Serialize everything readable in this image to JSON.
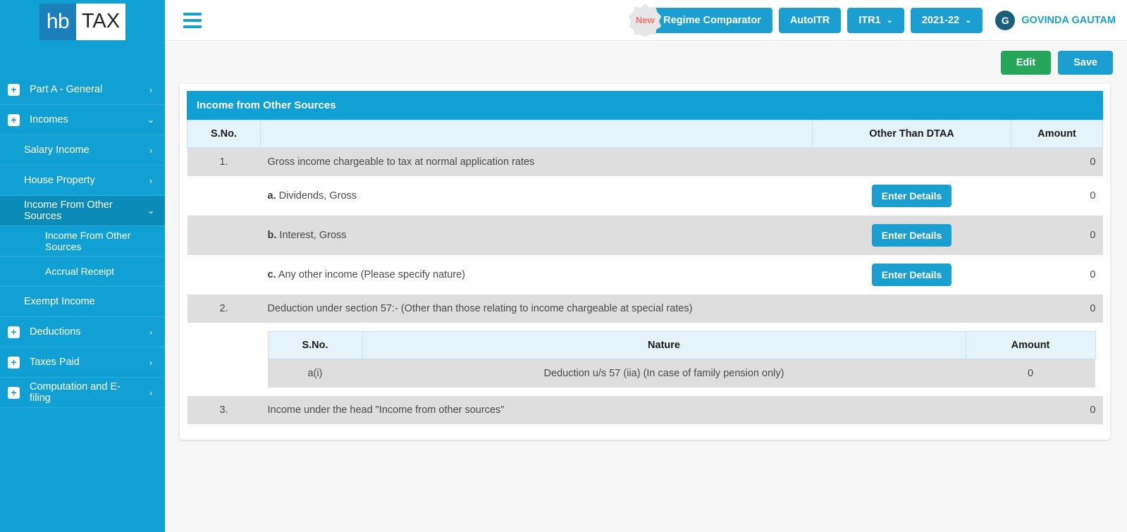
{
  "brand": {
    "logo_left": "hb",
    "logo_right": "TAX"
  },
  "sidebar": {
    "items": [
      {
        "label": "Part A - General",
        "level": "top",
        "icon": "plus-icon",
        "chevron": "›",
        "active": false
      },
      {
        "label": "Incomes",
        "level": "top",
        "icon": "plus-icon",
        "chevron": "⌄",
        "active": false
      },
      {
        "label": "Salary Income",
        "level": "sub",
        "chevron": "›",
        "active": false
      },
      {
        "label": "House Property",
        "level": "sub",
        "chevron": "›",
        "active": false
      },
      {
        "label": "Income From Other Sources",
        "level": "sub",
        "chevron": "⌄",
        "active": true
      },
      {
        "label": "Income From Other Sources",
        "level": "sub2",
        "chevron": "",
        "active": false
      },
      {
        "label": "Accrual Receipt",
        "level": "sub2",
        "chevron": "",
        "active": false
      },
      {
        "label": "Exempt Income",
        "level": "sub",
        "chevron": "",
        "active": false
      },
      {
        "label": "Deductions",
        "level": "top",
        "icon": "plus-icon",
        "chevron": "›",
        "active": false
      },
      {
        "label": "Taxes Paid",
        "level": "top",
        "icon": "plus-icon",
        "chevron": "›",
        "active": false
      },
      {
        "label": "Computation and E-filing",
        "level": "top",
        "icon": "plus-icon",
        "chevron": "›",
        "active": false
      }
    ]
  },
  "header": {
    "menu_icon": "hamburger-icon",
    "new_badge": "New",
    "regime_comparator": "Regime Comparator",
    "autoitr": "AutoITR",
    "itr_form": "ITR1",
    "assessment_year": "2021-22",
    "caret": "⌄",
    "avatar_initial": "G",
    "user_name": "GOVINDA GAUTAM"
  },
  "actions": {
    "edit": "Edit",
    "save": "Save"
  },
  "card": {
    "title": "Income from Other Sources",
    "columns": {
      "sno": "S.No.",
      "description": "",
      "other_than_dtaa": "Other Than DTAA",
      "amount": "Amount"
    },
    "rows": [
      {
        "sno": "1.",
        "desc_bold": "",
        "desc": "Gross income chargeable to tax at normal application rates",
        "button": "",
        "amount": "0",
        "shaded": true
      },
      {
        "sno": "",
        "desc_bold": "a.",
        "desc": "Dividends, Gross",
        "button": "Enter Details",
        "amount": "0",
        "shaded": false
      },
      {
        "sno": "",
        "desc_bold": "b.",
        "desc": "Interest, Gross",
        "button": "Enter Details",
        "amount": "0",
        "shaded": true
      },
      {
        "sno": "",
        "desc_bold": "c.",
        "desc": "Any other income (Please specify nature)",
        "button": "Enter Details",
        "amount": "0",
        "shaded": false
      },
      {
        "sno": "2.",
        "desc_bold": "",
        "desc": "Deduction under section 57:- (Other than those relating to income chargeable at special rates)",
        "button": "",
        "amount": "0",
        "shaded": true
      }
    ],
    "nested_table": {
      "columns": {
        "sno": "S.No.",
        "nature": "Nature",
        "amount": "Amount"
      },
      "rows": [
        {
          "sno": "a(i)",
          "nature": "Deduction u/s 57 (iia) (In case of family pension only)",
          "amount": "0"
        }
      ]
    },
    "final_row": {
      "sno": "3.",
      "desc": "Income under the head \"Income from other sources\"",
      "amount": "0"
    }
  },
  "colors": {
    "brand_blue": "#11a0d3",
    "sidebar_active": "#0b8bb8",
    "button_blue": "#1a9fd0",
    "edit_green": "#26a65b",
    "table_header": "#e5f3fb",
    "row_shade": "#dedede",
    "badge_red": "#f4746b"
  }
}
